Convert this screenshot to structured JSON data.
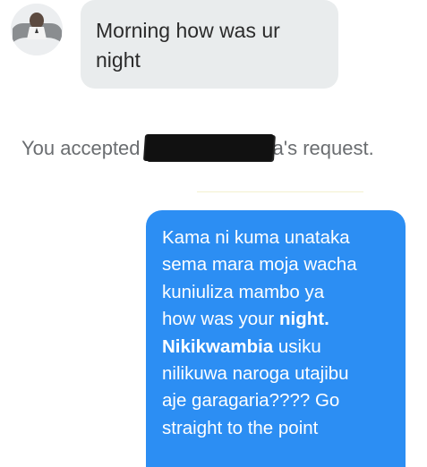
{
  "conversation": {
    "incoming_message": {
      "line1": "Morning how was ur",
      "line2": "night"
    },
    "system_notice": {
      "prefix": "You accepted",
      "suffix": "a's request."
    },
    "outgoing_message": {
      "line1": "Kama ni kuma unataka",
      "line2": "sema mara moja wacha",
      "line3": "kuniuliza mambo ya",
      "line4_a": "how was your ",
      "line4_b": "night.",
      "line5_a": "Nikikwambia",
      "line5_b": " usiku",
      "line6": "nilikuwa naroga utajibu",
      "line7": "aje garagaria???? Go",
      "line8": "straight to the point"
    }
  },
  "colors": {
    "incoming_bubble": "#e9eced",
    "outgoing_bubble": "#2c8ef3",
    "system_text": "#6a6d70"
  }
}
